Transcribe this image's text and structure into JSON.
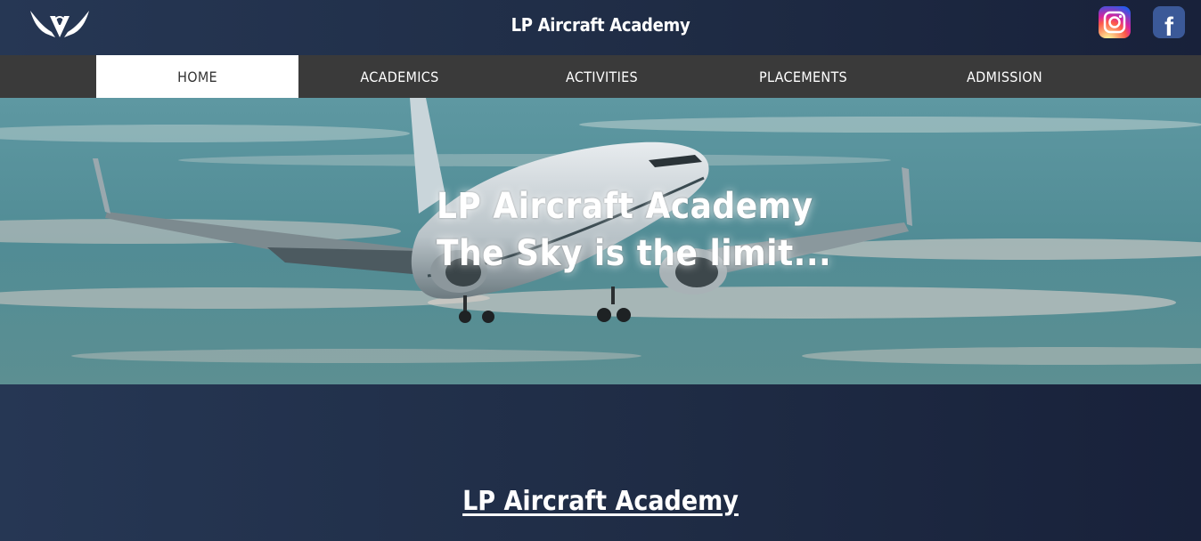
{
  "header": {
    "title": "LP Aircraft Academy",
    "logo_icon": "wings-logo-icon",
    "social": [
      {
        "name": "instagram",
        "icon": "instagram-icon"
      },
      {
        "name": "facebook",
        "icon": "facebook-icon",
        "glyph": "f"
      }
    ]
  },
  "nav": {
    "items": [
      {
        "label": "HOME",
        "active": true
      },
      {
        "label": "ACADEMICS",
        "active": false
      },
      {
        "label": "ACTIVITIES",
        "active": false
      },
      {
        "label": "PLACEMENTS",
        "active": false
      },
      {
        "label": "ADMISSION",
        "active": false
      }
    ]
  },
  "hero": {
    "line1": "LP Aircraft Academy",
    "line2": "The Sky is the limit..."
  },
  "main": {
    "heading": "LP Aircraft Academy"
  },
  "colors": {
    "header_bg": "#263754",
    "nav_bg": "#3a3a3a",
    "active_tab_bg": "#ffffff",
    "sky": "#5f9aa4",
    "facebook": "#3b5998"
  }
}
